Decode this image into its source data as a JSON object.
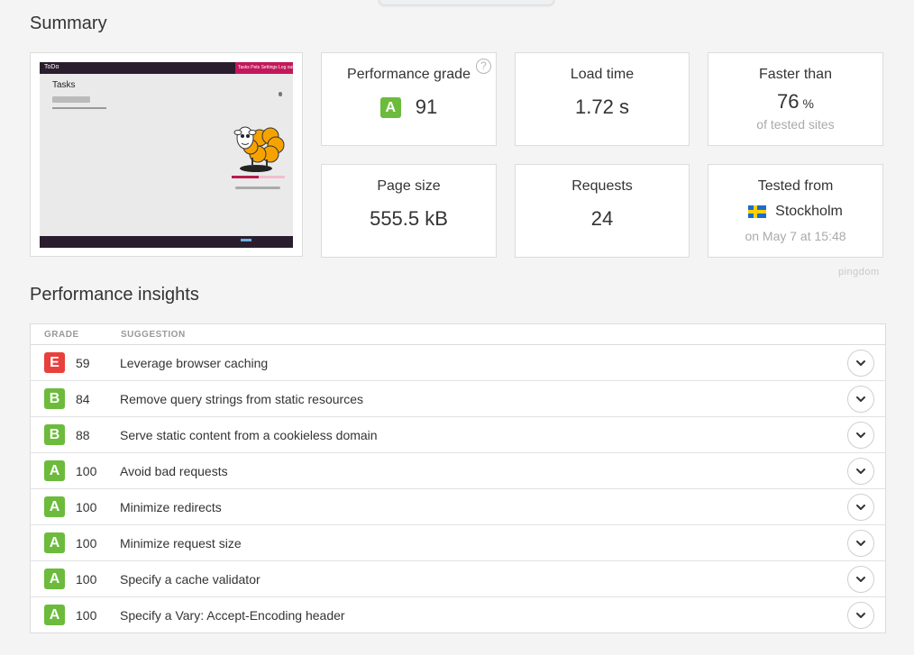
{
  "summary": {
    "title": "Summary",
    "screenshot": {
      "brand": "ToDo",
      "nav_links": "Tasks  Pets  Settings  Log out",
      "page_title": "Tasks"
    },
    "cards": {
      "performance_grade": {
        "label": "Performance grade",
        "grade": "A",
        "score": "91",
        "help": "?"
      },
      "load_time": {
        "label": "Load time",
        "value": "1.72 s"
      },
      "faster_than": {
        "label": "Faster than",
        "value": "76",
        "unit": "%",
        "sub": "of tested sites"
      },
      "page_size": {
        "label": "Page size",
        "value": "555.5 kB"
      },
      "requests": {
        "label": "Requests",
        "value": "24"
      },
      "tested_from": {
        "label": "Tested from",
        "location": "Stockholm",
        "date": "on May 7 at 15:48"
      }
    },
    "watermark": "pingdom"
  },
  "insights": {
    "title": "Performance insights",
    "columns": {
      "grade": "GRADE",
      "suggestion": "SUGGESTION"
    },
    "rows": [
      {
        "grade": "E",
        "score": "59",
        "suggestion": "Leverage browser caching"
      },
      {
        "grade": "B",
        "score": "84",
        "suggestion": "Remove query strings from static resources"
      },
      {
        "grade": "B",
        "score": "88",
        "suggestion": "Serve static content from a cookieless domain"
      },
      {
        "grade": "A",
        "score": "100",
        "suggestion": "Avoid bad requests"
      },
      {
        "grade": "A",
        "score": "100",
        "suggestion": "Minimize redirects"
      },
      {
        "grade": "A",
        "score": "100",
        "suggestion": "Minimize request size"
      },
      {
        "grade": "A",
        "score": "100",
        "suggestion": "Specify a cache validator"
      },
      {
        "grade": "A",
        "score": "100",
        "suggestion": "Specify a Vary: Accept-Encoding header"
      }
    ]
  },
  "colors": {
    "grade_a": "#6cbb3c",
    "grade_b": "#6cbb3c",
    "grade_e": "#e8403c"
  }
}
